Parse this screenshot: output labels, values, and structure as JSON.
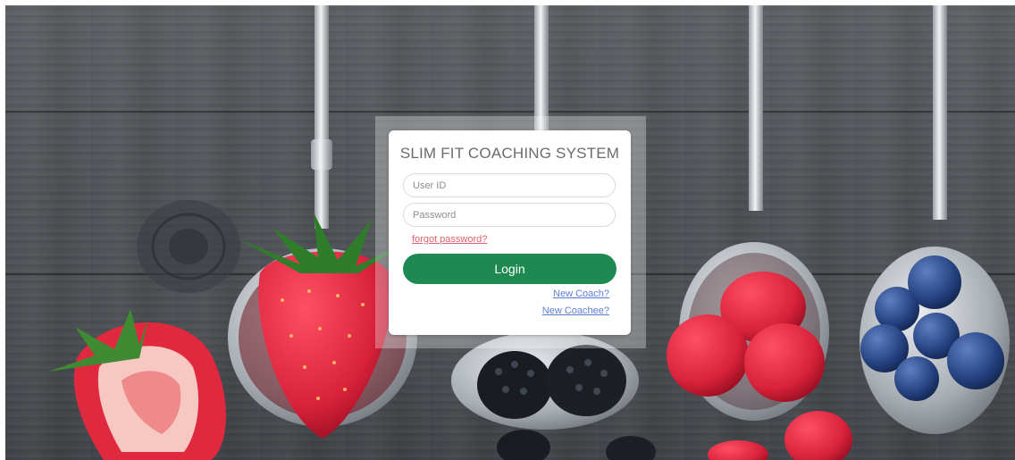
{
  "login": {
    "title": "SLIM FIT COACHING SYSTEM",
    "user_id_placeholder": "User ID",
    "password_placeholder": "Password",
    "forgot_password": "forgot password?",
    "login_label": "Login",
    "new_coach": "New Coach?",
    "new_coachee": "New Coachee?"
  },
  "colors": {
    "accent_green": "#1e8a52",
    "forgot_link": "#e0626a",
    "register_link": "#5b7fd6",
    "wood": "#4f5357"
  },
  "background": {
    "icons": [
      "wood-background",
      "spoon-icon",
      "strawberry-icon",
      "blackberry-icon",
      "raspberry-icon",
      "blueberry-icon"
    ]
  }
}
